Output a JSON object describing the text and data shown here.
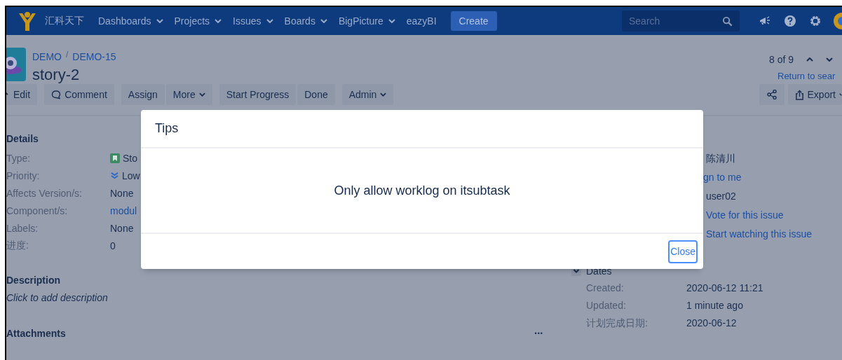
{
  "header": {
    "brand": "汇科天下",
    "nav": [
      {
        "label": "Dashboards",
        "dropdown": true
      },
      {
        "label": "Projects",
        "dropdown": true
      },
      {
        "label": "Issues",
        "dropdown": true
      },
      {
        "label": "Boards",
        "dropdown": true
      },
      {
        "label": "BigPicture",
        "dropdown": true
      },
      {
        "label": "eazyBI",
        "dropdown": false
      }
    ],
    "create": "Create",
    "search": {
      "placeholder": "Search"
    }
  },
  "breadcrumbs": {
    "separator": "/",
    "items": [
      "DEMO",
      "DEMO-15"
    ]
  },
  "issue_title": "story-2",
  "pager": {
    "position": "8 of 9",
    "return_link": "Return to sear"
  },
  "toolbar": [
    [
      {
        "label": "Edit",
        "kind": "edit"
      }
    ],
    [
      {
        "label": "Comment",
        "kind": "comment"
      }
    ],
    [
      {
        "label": "Assign",
        "kind": "plain"
      },
      {
        "label": "More",
        "kind": "dropdown"
      }
    ],
    [
      {
        "label": "Start Progress",
        "kind": "plain"
      },
      {
        "label": "Done",
        "kind": "plain"
      }
    ],
    [
      {
        "label": "Admin",
        "kind": "dropdown"
      }
    ]
  ],
  "toolbar_right": [
    {
      "kind": "share"
    },
    {
      "label": "Export",
      "kind": "export"
    }
  ],
  "details": {
    "heading": "Details",
    "fields": [
      {
        "label": "Type:",
        "value": "Sto",
        "kind": "type"
      },
      {
        "label": "Priority:",
        "value": "Low",
        "kind": "priority"
      },
      {
        "label": "Affects Version/s:",
        "value": "None",
        "kind": "text"
      },
      {
        "label": "Component/s:",
        "value": "modul",
        "kind": "link"
      },
      {
        "label": "Labels:",
        "value": "None",
        "kind": "text"
      },
      {
        "label": "进度:",
        "value": "0",
        "kind": "text"
      }
    ]
  },
  "description": {
    "heading": "Description",
    "text": "Click to add description"
  },
  "attachments": {
    "heading": "Attachments",
    "menu": "•••"
  },
  "people": [
    {
      "value": "陈清川",
      "kind": "text"
    },
    {
      "value": "gn to me",
      "kind": "link"
    },
    {
      "value": "user02",
      "kind": "text"
    },
    {
      "value": "Vote for this issue",
      "kind": "link"
    },
    {
      "value": "Start watching this issue",
      "kind": "link"
    }
  ],
  "dates": {
    "heading": "Dates",
    "expanded": true,
    "rows": [
      {
        "label": "Created:",
        "value": "2020-06-12 11:21"
      },
      {
        "label": "Updated:",
        "value": "1 minute ago"
      },
      {
        "label": "计划完成日期:",
        "value": "2020-06-12"
      }
    ]
  },
  "modal": {
    "title": "Tips",
    "message": "Only allow worklog on itsubtask",
    "button": "Close"
  }
}
